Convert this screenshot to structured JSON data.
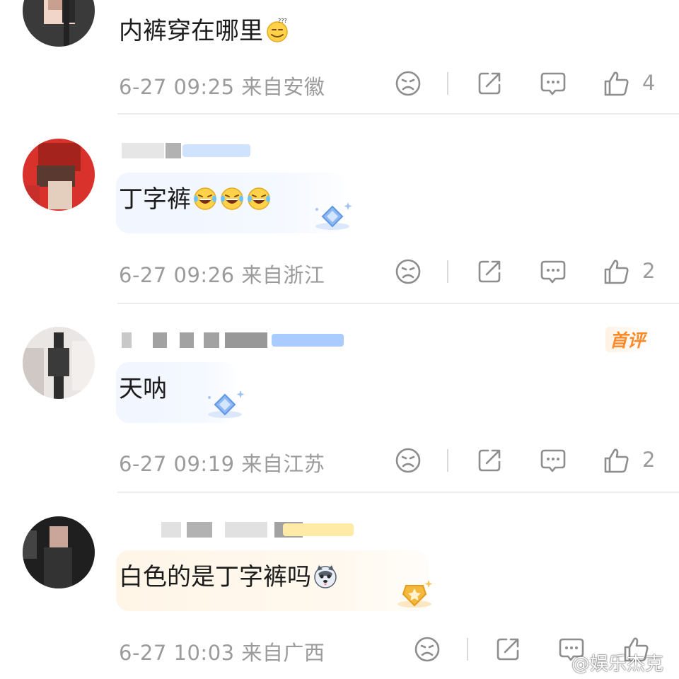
{
  "comments": [
    {
      "text": "内裤穿在哪里",
      "emoji": "sweat-smile-emoji",
      "time": "6-27 09:25 来自安徽",
      "likes": "4"
    },
    {
      "text": "丁字裤",
      "emoji": "laughing-tears-emoji",
      "time": "6-27 09:26 来自浙江",
      "likes": "2"
    },
    {
      "text": "天呐",
      "time": "6-27 09:19 来自江苏",
      "likes": "2",
      "tag": "首评"
    },
    {
      "text": "白色的是丁字裤吗",
      "emoji": "husky-emoji",
      "time": "6-27 10:03 来自广西",
      "likes": ""
    }
  ],
  "watermark": "@娱乐杰克",
  "icons": {
    "dislike": "sad-face-icon",
    "share": "share-icon",
    "reply": "comment-icon",
    "like": "thumbs-up-icon"
  },
  "colors": {
    "meta": "#9b9b9b",
    "tag": "#ff8a2a",
    "divider": "#ededed"
  }
}
